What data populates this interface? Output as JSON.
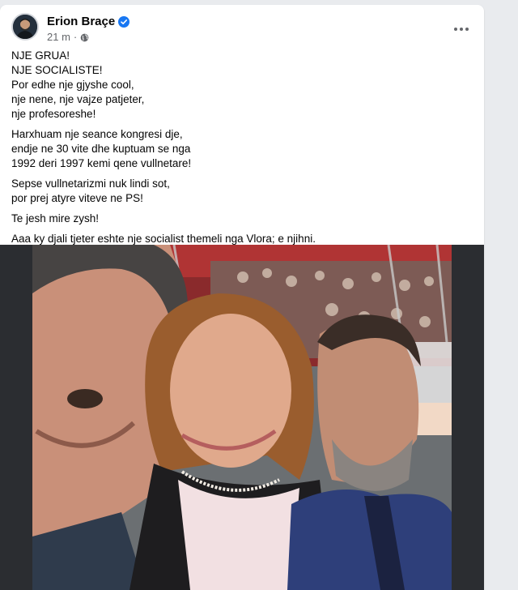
{
  "post": {
    "author": "Erion Braçe",
    "time": "21 m",
    "separator": "·",
    "icons": {
      "verified": "verified-badge-icon",
      "audience": "globe-icon",
      "more": "more-options-icon"
    },
    "text": {
      "paragraphs": [
        [
          "NJE GRUA!",
          "NJE SOCIALISTE!",
          "Por edhe nje gjyshe cool,",
          "nje nene, nje vajze patjeter,",
          "nje profesoreshe!"
        ],
        [
          "Harxhuam nje seance kongresi dje,",
          "endje ne 30 vite dhe kuptuam se nga",
          "1992 deri 1997 kemi qene vullnetare!"
        ],
        [
          "Sepse vullnetarizmi nuk lindi sot,",
          "por prej atyre viteve ne PS!"
        ],
        [
          "Te jesh mire zysh!"
        ],
        [
          "Aaa ky djali tjeter eshte nje socialist themeli nga Vlora; e njihni."
        ]
      ]
    },
    "photo": {
      "description_icon": "selfie-photo"
    }
  },
  "colors": {
    "accent": "#1877f2",
    "text_primary": "#050505",
    "text_secondary": "#65676b"
  }
}
